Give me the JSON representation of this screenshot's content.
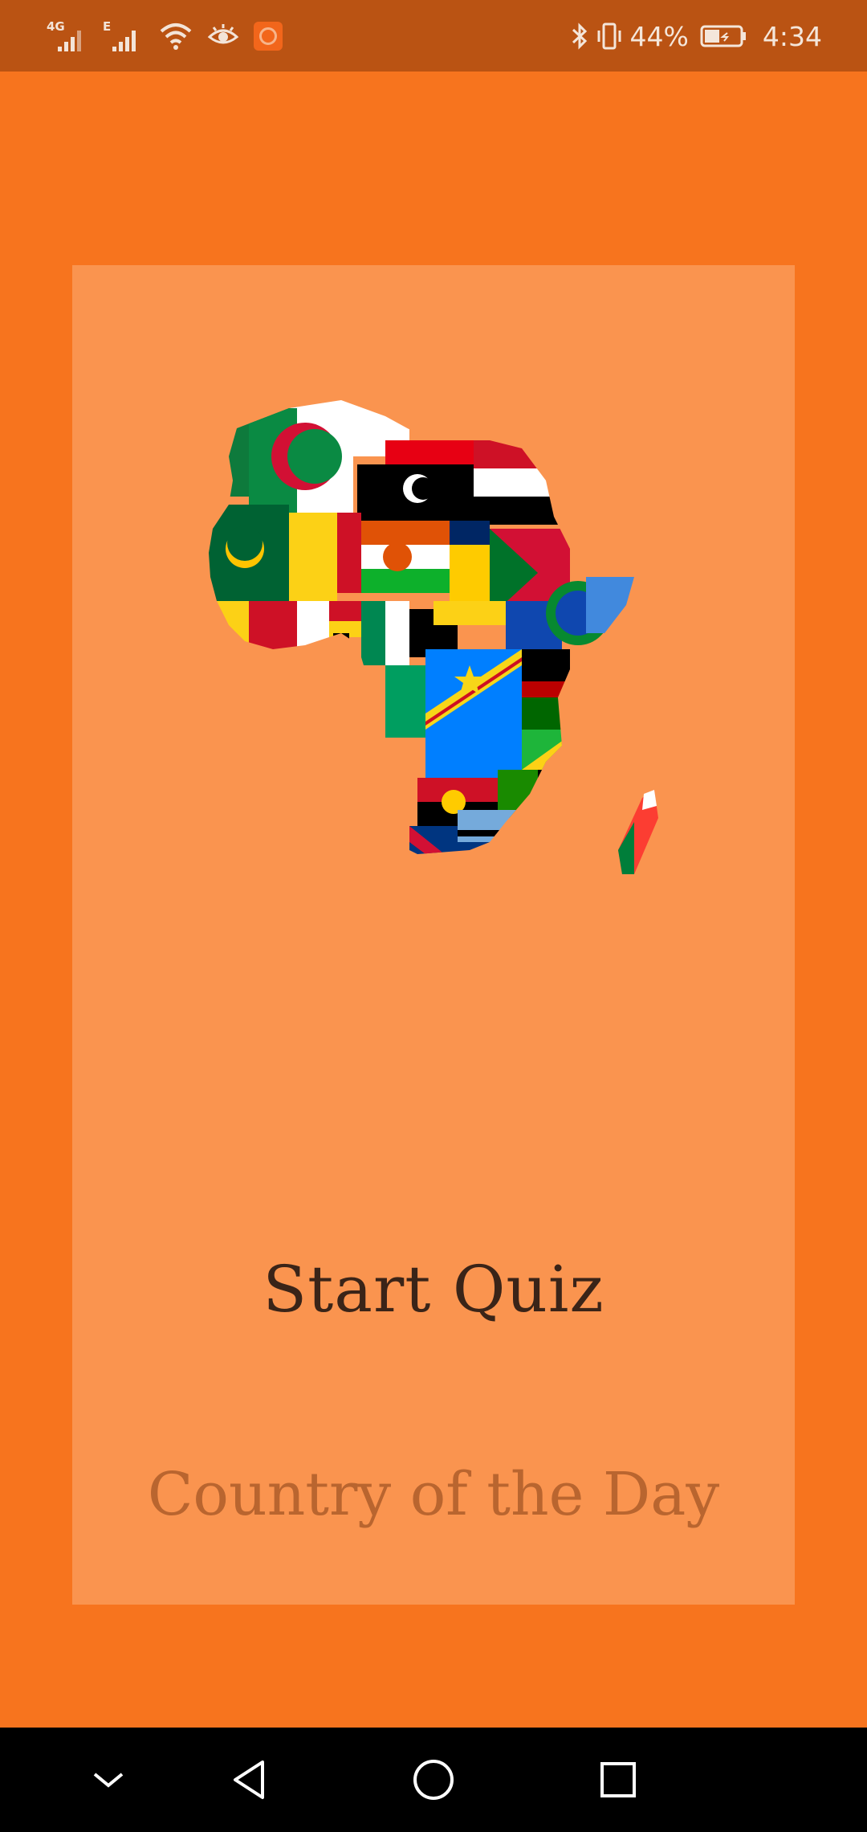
{
  "status_bar": {
    "net1_label": "4G",
    "net2_label": "E",
    "battery_percent": "44%",
    "battery_level": 0.44,
    "time": "4:34",
    "icons": [
      "signal-icon",
      "signal-icon",
      "wifi-icon",
      "eye-icon",
      "app-notification-icon",
      "bluetooth-icon",
      "vibrate-icon",
      "battery-icon"
    ]
  },
  "main": {
    "map_alt": "africa-flag-map",
    "start_quiz_label": "Start Quiz",
    "country_of_day_label": "Country of the Day"
  },
  "nav_bar": {
    "icons": [
      "chevron-down-icon",
      "back-icon",
      "home-icon",
      "recents-icon"
    ]
  },
  "colors": {
    "status_bar": "#BA5313",
    "background": "#F7741E",
    "card": "#FA944F",
    "primary_text": "#3A2418",
    "secondary_text": "#B9652F",
    "nav_bar": "#000000"
  }
}
